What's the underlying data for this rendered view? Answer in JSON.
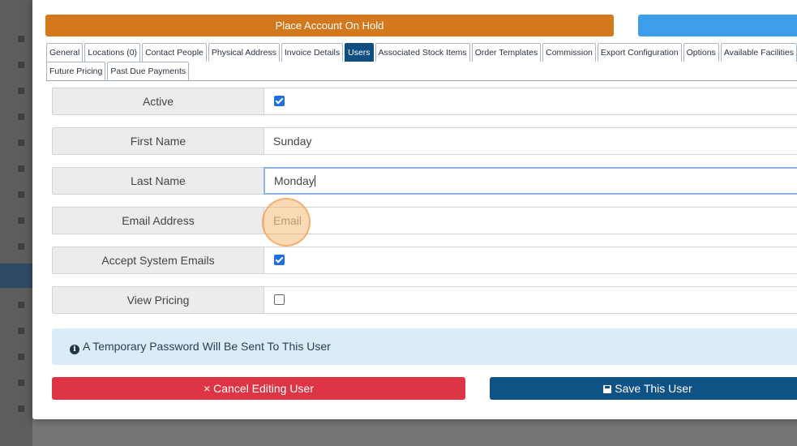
{
  "header": {
    "hold_label": "Place Account On Hold",
    "blue_button_label": ""
  },
  "tabs": {
    "row1": [
      {
        "label": "General",
        "active": false
      },
      {
        "label": "Locations (0)",
        "active": false
      },
      {
        "label": "Contact People",
        "active": false
      },
      {
        "label": "Physical Address",
        "active": false
      },
      {
        "label": "Invoice Details",
        "active": false
      },
      {
        "label": "Users",
        "active": true
      },
      {
        "label": "Associated Stock Items",
        "active": false
      },
      {
        "label": "Order Templates",
        "active": false
      },
      {
        "label": "Commission",
        "active": false
      },
      {
        "label": "Export Configuration",
        "active": false
      },
      {
        "label": "Options",
        "active": false
      },
      {
        "label": "Available Facilities",
        "active": false
      }
    ],
    "row2": [
      {
        "label": "Future Pricing",
        "active": false
      },
      {
        "label": "Past Due Payments",
        "active": false
      }
    ]
  },
  "form": {
    "active": {
      "label": "Active",
      "checked": true
    },
    "first_name": {
      "label": "First Name",
      "value": "Sunday"
    },
    "last_name": {
      "label": "Last Name",
      "value": "Monday"
    },
    "email": {
      "label": "Email Address",
      "value": "",
      "placeholder": "Email"
    },
    "accept_emails": {
      "label": "Accept System Emails",
      "checked": true
    },
    "view_pricing": {
      "label": "View Pricing",
      "checked": false
    }
  },
  "info": {
    "icon": "info-circle-icon",
    "text": "A Temporary Password Will Be Sent To This User"
  },
  "actions": {
    "cancel_label": "× Cancel Editing User",
    "save_label": "Save This User",
    "save_icon": "floppy-disk-icon"
  },
  "colors": {
    "hold": "#d3781d",
    "active_tab": "#0f4e80",
    "cancel": "#dd3545",
    "save": "#0f5285",
    "info_bg": "#d9ecf8"
  }
}
